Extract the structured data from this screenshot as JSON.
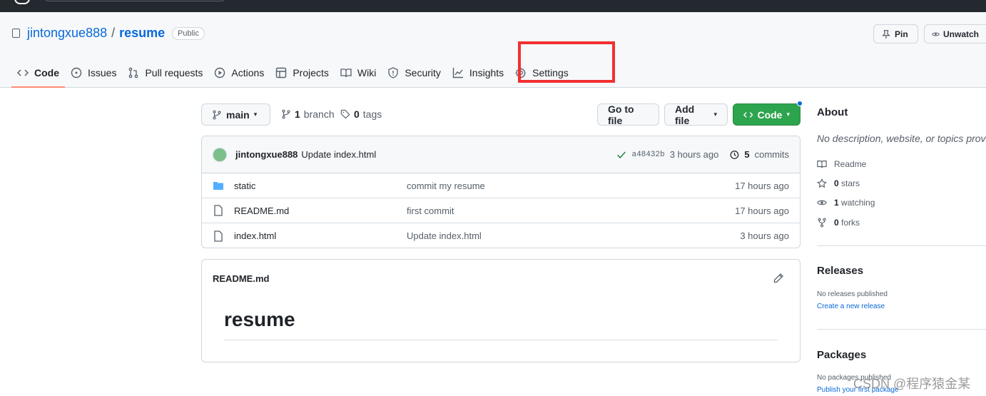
{
  "repo": {
    "owner": "jintongxue888",
    "separator": "/",
    "name": "resume",
    "visibility": "Public"
  },
  "header_buttons": {
    "pin": "Pin",
    "unwatch": "Unwatch"
  },
  "tabs": [
    {
      "label": "Code",
      "icon": "code-icon",
      "active": true
    },
    {
      "label": "Issues",
      "icon": "issue-icon"
    },
    {
      "label": "Pull requests",
      "icon": "pull-request-icon"
    },
    {
      "label": "Actions",
      "icon": "play-icon"
    },
    {
      "label": "Projects",
      "icon": "table-icon"
    },
    {
      "label": "Wiki",
      "icon": "book-icon"
    },
    {
      "label": "Security",
      "icon": "shield-icon"
    },
    {
      "label": "Insights",
      "icon": "graph-icon"
    },
    {
      "label": "Settings",
      "icon": "gear-icon"
    }
  ],
  "toolbar": {
    "branch": "main",
    "branch_count": "1",
    "branch_label": "branch",
    "tag_count": "0",
    "tag_label": "tags",
    "go_to_file": "Go to file",
    "add_file": "Add file",
    "code": "Code"
  },
  "commit": {
    "author": "jintongxue888",
    "message": "Update index.html",
    "sha": "a48432b",
    "time": "3 hours ago",
    "count": "5",
    "count_label": "commits"
  },
  "files": [
    {
      "name": "static",
      "type": "folder",
      "message": "commit my resume",
      "time": "17 hours ago"
    },
    {
      "name": "README.md",
      "type": "file",
      "message": "first commit",
      "time": "17 hours ago"
    },
    {
      "name": "index.html",
      "type": "file",
      "message": "Update index.html",
      "time": "3 hours ago"
    }
  ],
  "readme": {
    "filename": "README.md",
    "heading": "resume"
  },
  "about": {
    "title": "About",
    "description": "No description, website, or topics provided.",
    "readme": "Readme",
    "stars_count": "0",
    "stars_label": "stars",
    "watching_count": "1",
    "watching_label": "watching",
    "forks_count": "0",
    "forks_label": "forks"
  },
  "releases": {
    "title": "Releases",
    "empty": "No releases published",
    "link": "Create a new release"
  },
  "packages": {
    "title": "Packages",
    "empty": "No packages published",
    "link": "Publish your first package"
  },
  "watermark": "CSDN @程序猿金某",
  "colors": {
    "accent": "#0969da",
    "green": "#2da44e",
    "highlight": "#f23030",
    "tab_underline": "#fd8c73"
  }
}
